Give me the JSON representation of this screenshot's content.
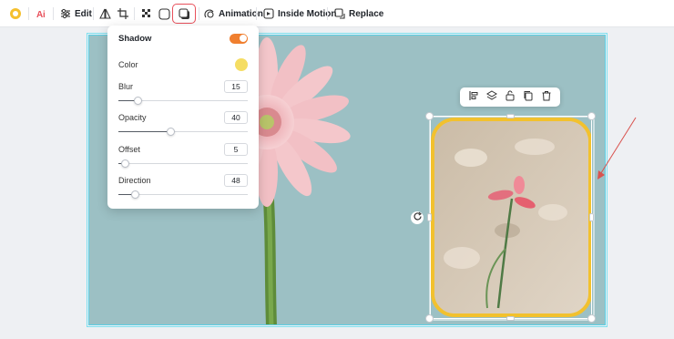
{
  "toolbar": {
    "items": [
      {
        "icon": "color-circle-icon"
      },
      {
        "icon": "ai-icon",
        "label": "AI"
      },
      {
        "icon": "sliders-icon",
        "label": "Edit"
      },
      {
        "icon": "flip-icon"
      },
      {
        "icon": "crop-icon"
      },
      {
        "icon": "transparency-icon"
      },
      {
        "icon": "rounded-corner-icon"
      },
      {
        "icon": "shadow-icon",
        "active": true
      },
      {
        "icon": "animation-icon",
        "label": "Animation"
      },
      {
        "icon": "inside-motion-icon",
        "label": "Inside Motion"
      },
      {
        "icon": "replace-icon",
        "label": "Replace"
      }
    ]
  },
  "shadow_panel": {
    "title": "Shadow",
    "enabled": true,
    "color_label": "Color",
    "color_value": "#f5dd63",
    "blur": {
      "label": "Blur",
      "value": "15",
      "fraction": 0.15
    },
    "opacity": {
      "label": "Opacity",
      "value": "40",
      "fraction": 0.4
    },
    "offset": {
      "label": "Offset",
      "value": "5",
      "fraction": 0.05
    },
    "direction": {
      "label": "Direction",
      "value": "48",
      "fraction": 0.13
    }
  },
  "object_toolbar": {
    "icons": [
      "align-icon",
      "layers-icon",
      "lock-icon",
      "duplicate-icon",
      "delete-icon"
    ]
  },
  "colors": {
    "accent": "#e8505b",
    "toggle": "#f07f2f",
    "canvas_bg": "#9cc0c4",
    "frame_border": "#f2c12e",
    "selection": "#5ad0e6"
  }
}
